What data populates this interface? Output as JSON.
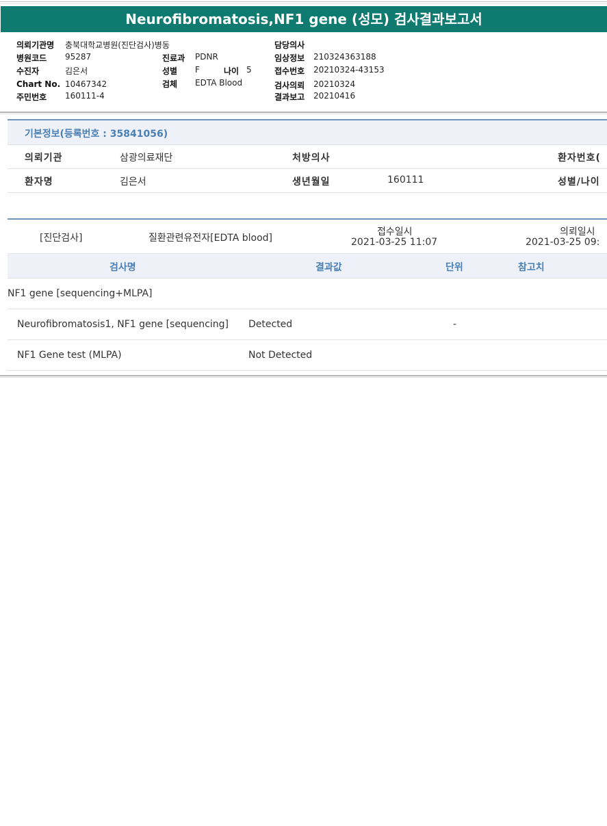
{
  "report": {
    "title": "Neurofibromatosis,NF1 gene (성모) 검사결과보고서"
  },
  "header": {
    "institution": {
      "label": "의뢰기관명",
      "value": "충북대학교병원(진단검사)병동"
    },
    "hospital_code": {
      "label": "병원코드",
      "value": "95287"
    },
    "patient": {
      "label": "수진자",
      "value": "김은서"
    },
    "chart_no": {
      "label": "Chart No.",
      "value": "10467342"
    },
    "resident_no": {
      "label": "주민번호",
      "value": "160111-4"
    },
    "department": {
      "label": "진료과",
      "value": "PDNR"
    },
    "sex": {
      "label": "성별",
      "value": "F"
    },
    "age": {
      "label": "나이",
      "value": "5"
    },
    "specimen": {
      "label": "검체",
      "value": "EDTA Blood"
    },
    "doctor": {
      "label": "담당의사",
      "value": ""
    },
    "clinical_info": {
      "label": "임상정보",
      "value": "210324363188"
    },
    "accession_no": {
      "label": "접수번호",
      "value": "20210324-43153"
    },
    "test_request": {
      "label": "검사의뢰",
      "value": "20210324"
    },
    "result_report": {
      "label": "결과보고",
      "value": "20210416"
    }
  },
  "basic_info": {
    "title": "기본정보(등록번호 : 35841056)",
    "rows": [
      {
        "l1": "의뢰기관",
        "v1": "삼광의료재단",
        "l2": "처방의사",
        "v2": "",
        "l3": "환자번호("
      },
      {
        "l1": "환자명",
        "v1": "김은서",
        "l2": "생년월일",
        "v2": "160111",
        "l3": "성별/나이"
      }
    ]
  },
  "test_info": {
    "category": "[진단검사]",
    "test_type": "질환관련유전자[EDTA blood]",
    "received_label": "접수일시",
    "received_value": "2021-03-25 11:07",
    "requested_label": "의뢰일시",
    "requested_value": "2021-03-25 09:"
  },
  "results_table": {
    "headers": [
      "검사명",
      "결과값",
      "단위",
      "참고치"
    ],
    "group": "NF1 gene [sequencing+MLPA]",
    "rows": [
      {
        "name": "Neurofibromatosis1, NF1 gene [sequencing]",
        "result": "Detected",
        "unit": "-",
        "ref": ""
      },
      {
        "name": "NF1 Gene test (MLPA)",
        "result": "Not Detected",
        "unit": "",
        "ref": ""
      }
    ]
  }
}
